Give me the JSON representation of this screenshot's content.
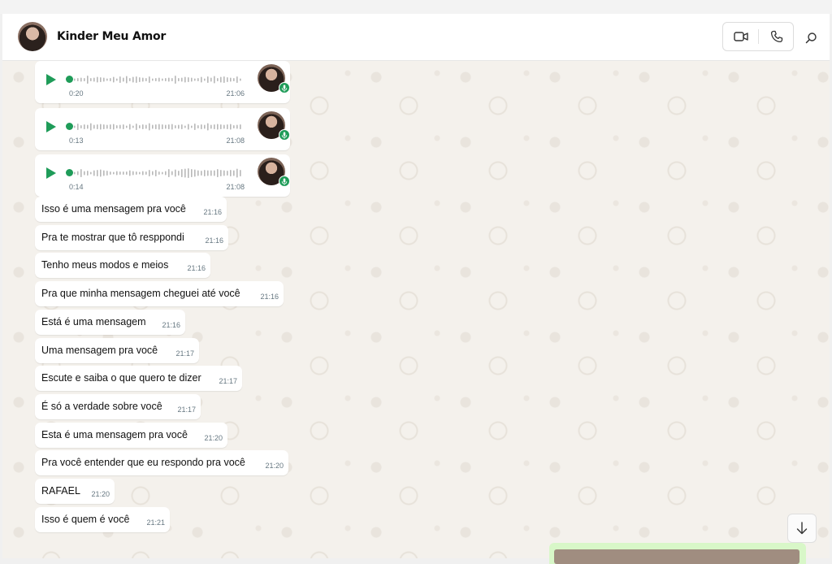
{
  "header": {
    "contact_name": "Kinder Meu Amor",
    "icons": [
      "avatar",
      "video-call-icon",
      "voice-call-icon",
      "search-icon"
    ]
  },
  "colors": {
    "accent_green": "#1f9c59",
    "bubble_bg": "#ffffff",
    "chat_bg": "#f4f1ec",
    "timestamp": "#667781"
  },
  "voice_messages": [
    {
      "duration": "0:20",
      "time": "21:06",
      "progress": 0
    },
    {
      "duration": "0:13",
      "time": "21:08",
      "progress": 0
    },
    {
      "duration": "0:14",
      "time": "21:08",
      "progress": 0
    }
  ],
  "messages": [
    {
      "text": "Isso é uma mensagem pra você",
      "time": "21:16"
    },
    {
      "text": "Pra te mostrar que tô resppondi",
      "time": "21:16"
    },
    {
      "text": "Tenho meus modos e meios",
      "time": "21:16"
    },
    {
      "text": "Pra que minha mensagem cheguei até você",
      "time": "21:16"
    },
    {
      "text": "Está é uma mensagem",
      "time": "21:16"
    },
    {
      "text": "Uma mensagem pra você",
      "time": "21:17"
    },
    {
      "text": "Escute e saiba o que quero te dizer",
      "time": "21:17"
    },
    {
      "text": "É só a verdade sobre você",
      "time": "21:17"
    },
    {
      "text": "Esta é uma mensagem pra você",
      "time": "21:20"
    },
    {
      "text": "Pra você entender que eu respondo pra você",
      "time": "21:20"
    },
    {
      "text": "RAFAEL",
      "time": "21:20"
    },
    {
      "text": "Isso é quem é você",
      "time": "21:21"
    }
  ]
}
